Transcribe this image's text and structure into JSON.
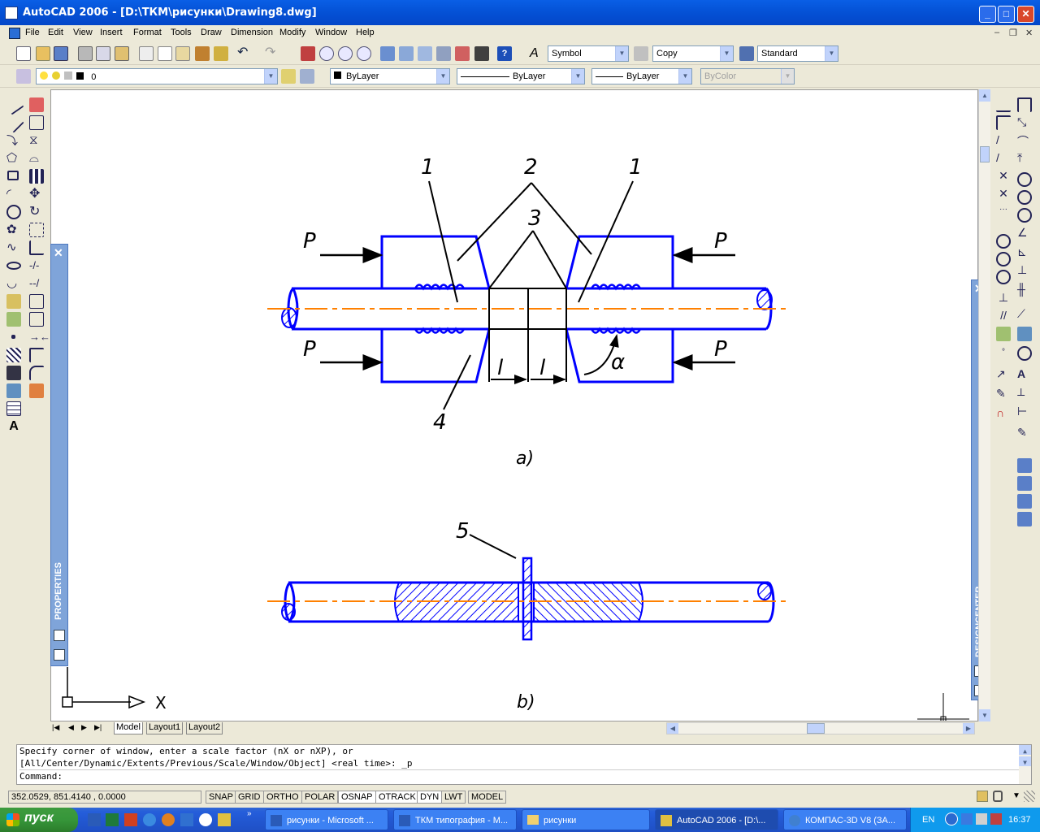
{
  "window": {
    "title": "AutoCAD 2006 - [D:\\ТКМ\\рисунки\\Drawing8.dwg]"
  },
  "menu": [
    "File",
    "Edit",
    "View",
    "Insert",
    "Format",
    "Tools",
    "Draw",
    "Dimension",
    "Modify",
    "Window",
    "Help"
  ],
  "toolbar": {
    "text_style": "Symbol",
    "dim_style": "Copy",
    "table_style": "Standard",
    "layer": "0",
    "color": "ByLayer",
    "linetype": "ByLayer",
    "lineweight": "ByLayer",
    "plotstyle": "ByColor"
  },
  "drawing": {
    "part_a": {
      "labels": [
        "1",
        "2",
        "1",
        "3",
        "4"
      ],
      "force": "P",
      "length": "l",
      "angle": "α",
      "caption": "a)"
    },
    "part_b": {
      "label": "5",
      "caption": "b)"
    },
    "ucs": {
      "x_label": "X"
    }
  },
  "panels": {
    "properties": "PROPERTIES",
    "designcenter": "DESIGNCENTER"
  },
  "tabs": [
    "Model",
    "Layout1",
    "Layout2"
  ],
  "command": {
    "line1": "Specify corner of window, enter a scale factor (nX or nXP), or",
    "line2": "[All/Center/Dynamic/Extents/Previous/Scale/Window/Object] <real time>: _p",
    "prompt": "Command:"
  },
  "status": {
    "coords": "352.0529, 851.4140 , 0.0000",
    "buttons": [
      "SNAP",
      "GRID",
      "ORTHO",
      "POLAR",
      "OSNAP",
      "OTRACK",
      "DYN",
      "LWT",
      "MODEL"
    ]
  },
  "taskbar": {
    "start": "пуск",
    "tasks": [
      "рисунки - Microsoft ...",
      "ТКМ типография - М...",
      "рисунки",
      "AutoCAD 2006 - [D:\\...",
      "КОМПАС-3D V8 (ЗА..."
    ],
    "lang": "EN",
    "clock": "16:37"
  },
  "colors": {
    "outline": "#0000FF",
    "centerline": "#FF8000",
    "titlebar": "#0553D8"
  }
}
